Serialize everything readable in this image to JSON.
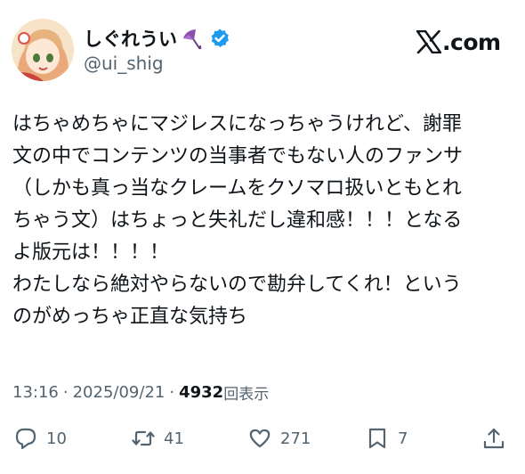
{
  "author": {
    "display_name": "しぐれうい",
    "handle": "@ui_shig"
  },
  "brand": {
    "logo_suffix": ".com"
  },
  "tweet": {
    "lines": [
      "はちゃめちゃにマジレスになっちゃうけれど、謝罪",
      "文の中でコンテンツの当事者でもない人のファンサ",
      "（しかも真っ当なクレームをクソマロ扱いともとれ",
      "ちゃう文）はちょっと失礼だし違和感！！！となる",
      "よ版元は！！！！",
      "わたしなら絶対やらないので勘弁してくれ！という",
      "のがめっちゃ正直な気持ち"
    ]
  },
  "meta": {
    "time": "13:16",
    "date": "2025/09/21",
    "separator": "·",
    "views_count": "4932",
    "views_label": "回表示"
  },
  "actions": {
    "reply_count": "10",
    "repost_count": "41",
    "like_count": "271",
    "bookmark_count": "7"
  },
  "colors": {
    "verified": "#1d9bf0",
    "text": "#0f1419",
    "muted": "#536471"
  },
  "icons": [
    "verified-badge-icon",
    "umbrella-icon",
    "x-logo-icon",
    "reply-icon",
    "repost-icon",
    "like-icon",
    "bookmark-icon",
    "share-icon"
  ]
}
